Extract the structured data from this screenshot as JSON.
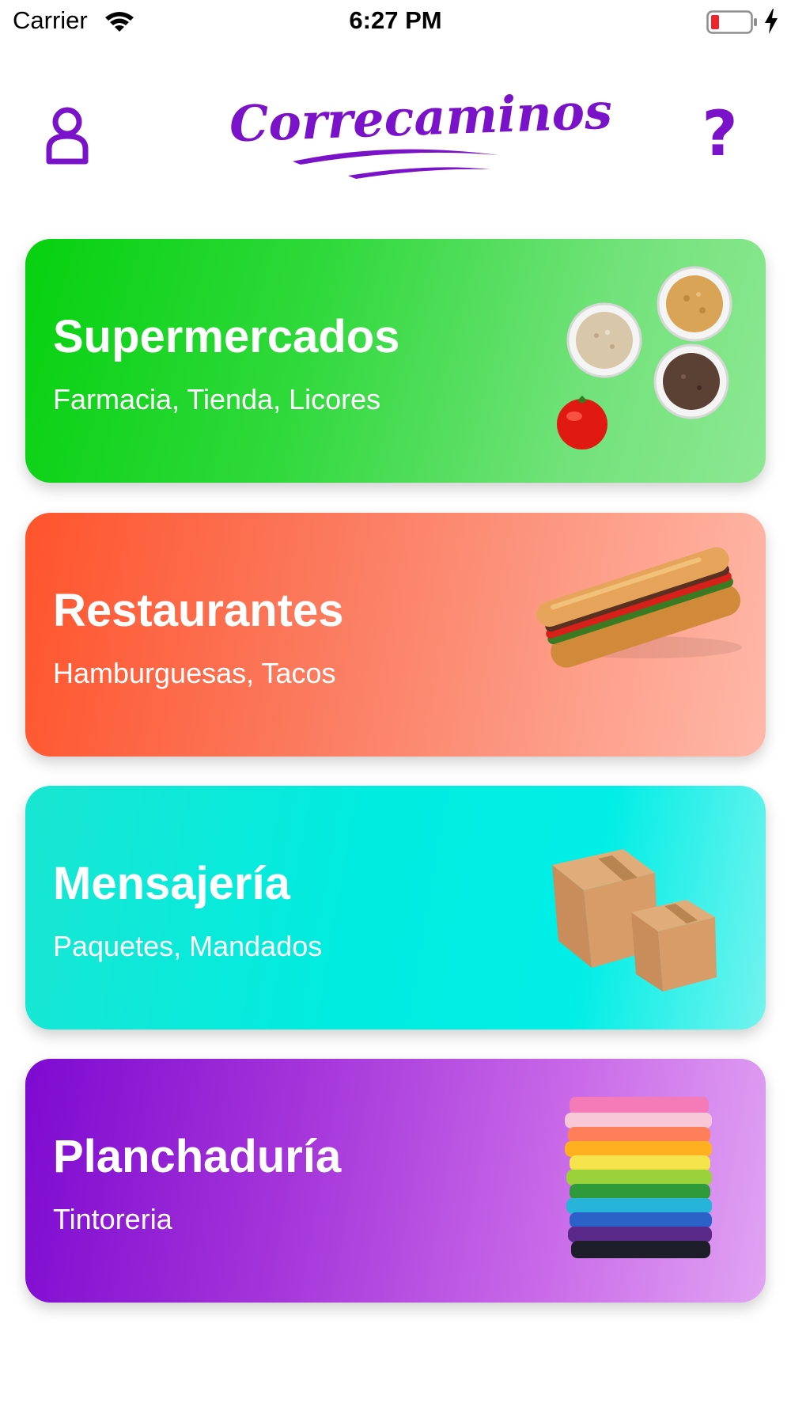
{
  "status_bar": {
    "carrier": "Carrier",
    "time": "6:27 PM",
    "battery_icon": "battery-low-icon",
    "charging_icon": "charging-bolt-icon",
    "wifi_icon": "wifi-icon"
  },
  "header": {
    "logo_text": "Correcaminos",
    "profile_icon": "user-profile-icon",
    "help_label": "?",
    "brand_color": "#7a12c9"
  },
  "categories": [
    {
      "title": "Supermercados",
      "subtitle": "Farmacia, Tienda, Licores",
      "image": "spice-bowls-and-tomato",
      "color": "#06d10f"
    },
    {
      "title": "Restaurantes",
      "subtitle": "Hamburguesas, Tacos",
      "image": "sandwich",
      "color": "#ff542c"
    },
    {
      "title": "Mensajería",
      "subtitle": "Paquetes, Mandados",
      "image": "cardboard-boxes",
      "color": "#00ece0"
    },
    {
      "title": "Planchaduría",
      "subtitle": "Tintoreria",
      "image": "folded-clothes-stack",
      "color": "#7d0ad0"
    }
  ]
}
